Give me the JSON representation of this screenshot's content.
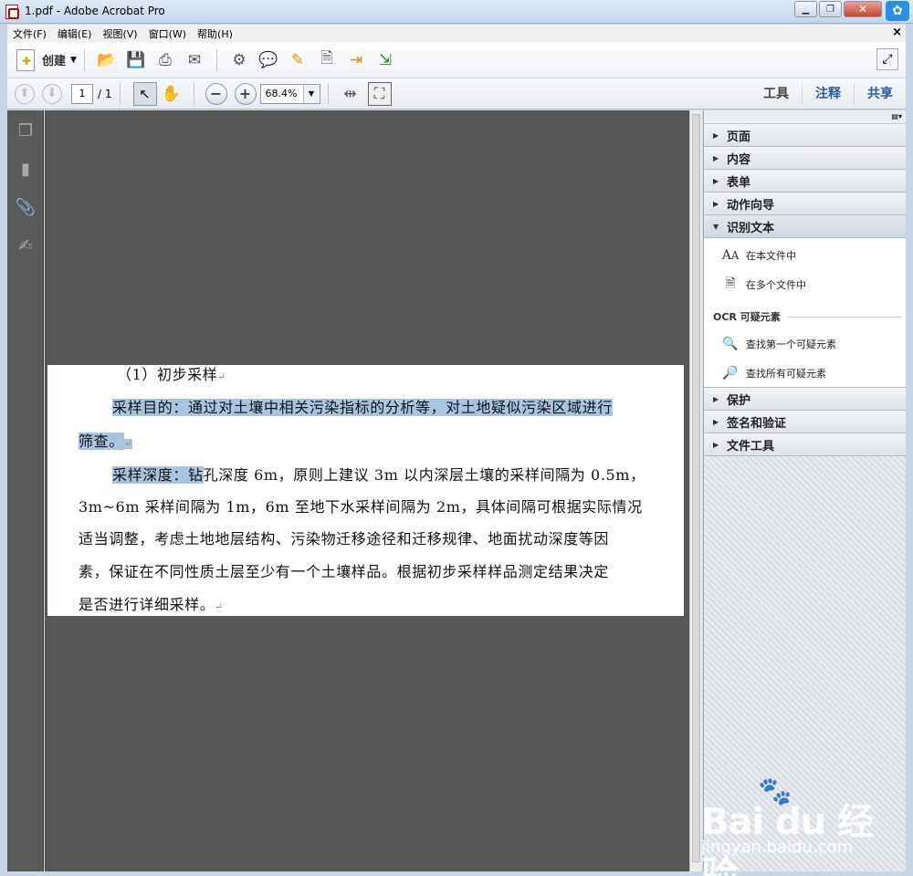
{
  "window": {
    "title": "1.pdf - Adobe Acrobat Pro"
  },
  "menu": [
    "文件(F)",
    "编辑(E)",
    "视图(V)",
    "窗口(W)",
    "帮助(H)"
  ],
  "toolbar": {
    "create_label": "创建"
  },
  "nav": {
    "page_current": "1",
    "page_total": "/ 1",
    "zoom": "68.4%"
  },
  "tabs": {
    "tools": "工具",
    "comment": "注释",
    "share": "共享"
  },
  "document": {
    "lines": [
      "（1）初步采样",
      "采样目的：通过对土壤中相关污染指标的分析等，对土地疑似污染区域进行",
      "筛查。",
      "采样深度：钻",
      "孔深度 6m，原则上建议 3m 以内深层土壤的采样间隔为 0.5m，",
      "3m~6m 采样间隔为 1m，6m 至地下水采样间隔为 2m，具体间隔可根据实际情况",
      "适当调整，考虑土地地层结构、污染物迁移途径和迁移规律、地面扰动深度等因",
      "素，保证在不同性质土层至少有一个土壤样品。根据初步采样样品测定结果决定",
      "是否进行详细采样。"
    ]
  },
  "panel": {
    "sections_top": [
      "页面",
      "内容",
      "表单",
      "动作向导"
    ],
    "open_section": "识别文本",
    "items": [
      "在本文件中",
      "在多个文件中"
    ],
    "ocr_heading": "OCR 可疑元素",
    "ocr_items": [
      "查找第一个可疑元素",
      "查找所有可疑元素"
    ],
    "sections_bottom": [
      "保护",
      "签名和验证",
      "文件工具"
    ]
  },
  "watermark": {
    "brand": "Bai du 经验",
    "url": "jingyan.baidu.com"
  },
  "colors": {
    "highlight": "#a8c4df",
    "doc_background": "#575757",
    "accent_blue": "#2b5f9a"
  }
}
